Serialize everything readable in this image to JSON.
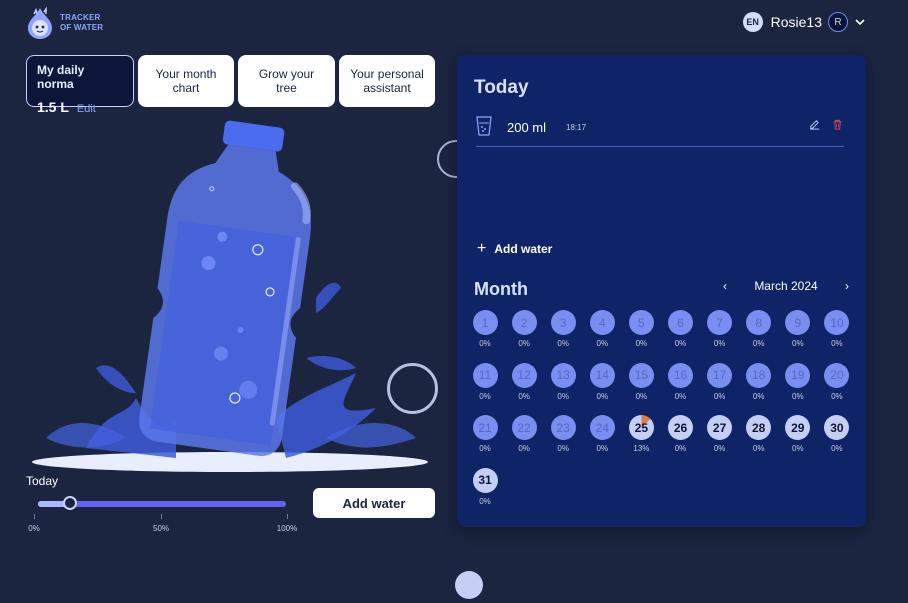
{
  "brand": {
    "line1": "TRACKER",
    "line2": "OF WATER",
    "logo_icon": "water-drop-mascot-icon"
  },
  "user": {
    "language": "EN",
    "name": "Rosie13",
    "avatar_letter": "R"
  },
  "daily_norma": {
    "title": "My daily norma",
    "value": "1.5 L",
    "edit_label": "Edit"
  },
  "tabs": [
    {
      "label": "Your month chart"
    },
    {
      "label": "Grow your tree"
    },
    {
      "label": "Your personal assistant"
    }
  ],
  "tabs_text": [
    "Your month\nchart",
    "Grow your\ntree",
    "Your personal\nassistant"
  ],
  "progress": {
    "label": "Today",
    "value_fraction": 0.13,
    "ticks": [
      "0%",
      "50%",
      "100%"
    ]
  },
  "add_water_button": "Add water",
  "today_panel": {
    "title": "Today",
    "entries": [
      {
        "amount": "200 ml",
        "time": "18:17"
      }
    ],
    "add_water_link": "Add water"
  },
  "month_panel": {
    "title": "Month",
    "month_label": "March 2024",
    "prev": "‹",
    "next": "›",
    "days": [
      {
        "n": "1",
        "pct": "0%",
        "state": "past"
      },
      {
        "n": "2",
        "pct": "0%",
        "state": "past"
      },
      {
        "n": "3",
        "pct": "0%",
        "state": "past"
      },
      {
        "n": "4",
        "pct": "0%",
        "state": "past"
      },
      {
        "n": "5",
        "pct": "0%",
        "state": "past"
      },
      {
        "n": "6",
        "pct": "0%",
        "state": "past"
      },
      {
        "n": "7",
        "pct": "0%",
        "state": "past"
      },
      {
        "n": "8",
        "pct": "0%",
        "state": "past"
      },
      {
        "n": "9",
        "pct": "0%",
        "state": "past"
      },
      {
        "n": "10",
        "pct": "0%",
        "state": "past"
      },
      {
        "n": "11",
        "pct": "0%",
        "state": "past"
      },
      {
        "n": "12",
        "pct": "0%",
        "state": "past"
      },
      {
        "n": "13",
        "pct": "0%",
        "state": "past"
      },
      {
        "n": "14",
        "pct": "0%",
        "state": "past"
      },
      {
        "n": "15",
        "pct": "0%",
        "state": "past"
      },
      {
        "n": "16",
        "pct": "0%",
        "state": "past"
      },
      {
        "n": "17",
        "pct": "0%",
        "state": "past"
      },
      {
        "n": "18",
        "pct": "0%",
        "state": "past"
      },
      {
        "n": "19",
        "pct": "0%",
        "state": "past"
      },
      {
        "n": "20",
        "pct": "0%",
        "state": "past"
      },
      {
        "n": "21",
        "pct": "0%",
        "state": "past"
      },
      {
        "n": "22",
        "pct": "0%",
        "state": "past"
      },
      {
        "n": "23",
        "pct": "0%",
        "state": "past"
      },
      {
        "n": "24",
        "pct": "0%",
        "state": "past"
      },
      {
        "n": "25",
        "pct": "13%",
        "state": "today"
      },
      {
        "n": "26",
        "pct": "0%",
        "state": "future"
      },
      {
        "n": "27",
        "pct": "0%",
        "state": "future"
      },
      {
        "n": "28",
        "pct": "0%",
        "state": "future"
      },
      {
        "n": "29",
        "pct": "0%",
        "state": "future"
      },
      {
        "n": "30",
        "pct": "0%",
        "state": "future"
      },
      {
        "n": "31",
        "pct": "0%",
        "state": "future"
      }
    ]
  },
  "colors": {
    "background": "#1b2540",
    "panel": "#0e2467",
    "accent": "#5f63f0",
    "light_accent": "#c5cff6",
    "delete": "#e0475a"
  }
}
